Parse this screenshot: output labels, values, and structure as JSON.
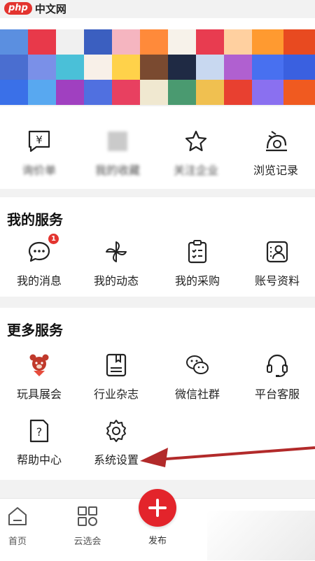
{
  "watermark": {
    "logo": "php",
    "text": "中文网"
  },
  "quick_links": [
    {
      "label": "询价单",
      "icon": "yen-chat-icon"
    },
    {
      "label": "我的收藏",
      "icon": "folder-icon"
    },
    {
      "label": "关注企业",
      "icon": "star-icon"
    },
    {
      "label": "浏览记录",
      "icon": "history-icon"
    }
  ],
  "my_services": {
    "title": "我的服务",
    "items": [
      {
        "label": "我的消息",
        "icon": "message-icon",
        "badge": "1"
      },
      {
        "label": "我的动态",
        "icon": "pinwheel-icon"
      },
      {
        "label": "我的采购",
        "icon": "checklist-icon"
      },
      {
        "label": "账号资料",
        "icon": "account-icon"
      }
    ]
  },
  "more_services": {
    "title": "更多服务",
    "items": [
      {
        "label": "玩具展会",
        "icon": "toy-bear-icon"
      },
      {
        "label": "行业杂志",
        "icon": "magazine-icon"
      },
      {
        "label": "微信社群",
        "icon": "wechat-icon"
      },
      {
        "label": "平台客服",
        "icon": "headset-icon"
      },
      {
        "label": "帮助中心",
        "icon": "help-doc-icon"
      },
      {
        "label": "系统设置",
        "icon": "gear-icon"
      }
    ]
  },
  "tabbar": {
    "home": "首页",
    "cloud": "云选会",
    "publish": "发布"
  },
  "colors": {
    "brand_red": "#e3242b",
    "background": "#f2f2f2"
  }
}
